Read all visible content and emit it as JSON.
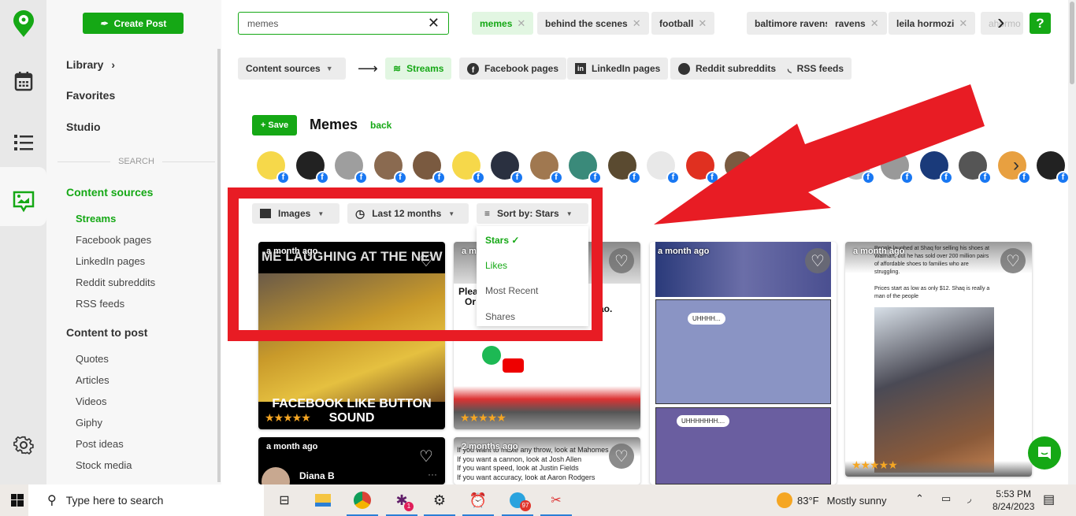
{
  "sidebar": {
    "create_post": "Create Post",
    "library": "Library",
    "favorites": "Favorites",
    "studio": "Studio",
    "search_divider": "SEARCH",
    "content_sources": {
      "label": "Content sources",
      "items": [
        "Streams",
        "Facebook pages",
        "LinkedIn pages",
        "Reddit subreddits",
        "RSS feeds"
      ]
    },
    "content_to_post": {
      "label": "Content to post",
      "items": [
        "Quotes",
        "Articles",
        "Videos",
        "Giphy",
        "Post ideas",
        "Stock media"
      ]
    }
  },
  "search": {
    "value": "memes"
  },
  "tags": [
    "memes",
    "behind the scenes",
    "football",
    "baltimore ravens",
    "ravens",
    "leila hormozi",
    "ahormo"
  ],
  "help_label": "?",
  "sources": {
    "dropdown": "Content sources",
    "items": [
      "Streams",
      "Facebook pages",
      "LinkedIn pages",
      "Reddit subreddits",
      "RSS feeds"
    ]
  },
  "stream": {
    "save": "+ Save",
    "title": "Memes",
    "back": "back"
  },
  "filters": {
    "type": "Images",
    "period": "Last 12 months",
    "sort": "Sort by: Stars",
    "sort_options": [
      "Stars",
      "Likes",
      "Most Recent",
      "Shares"
    ],
    "selected": "Stars"
  },
  "cards": [
    {
      "ago": "a month ago",
      "top_text": "ME LAUGHING AT THE NEW",
      "bottom_text": "FACEBOOK LIKE BUTTON SOUND",
      "stars": "★★★★★"
    },
    {
      "ago": "a month ago",
      "text1": "Plea",
      "text2": "Or",
      "text3": "ao.",
      "stars": "★★★★★"
    },
    {
      "ago": "a month ago",
      "bubble1": "UHHHH...",
      "bubble2": "UHHHHHHH...."
    },
    {
      "ago": "a month ago",
      "caption": "People laughed at Shaq for selling his shoes at Walmart, but he has sold over 200 million pairs of affordable shoes to families who are struggling.",
      "caption2": "Prices start as low as only $12. Shaq is really a man of the people",
      "stars": "★★★★★"
    },
    {
      "ago": "a month ago",
      "author": "Diana B"
    },
    {
      "ago": "2 months ago",
      "lines": [
        "If you want to make any throw, look at Mahomes",
        "If you want a cannon, look at Josh Allen",
        "If you want speed, look at Justin Fields",
        "If you want accuracy, look at Aaron Rodgers"
      ]
    }
  ],
  "taskbar": {
    "search_placeholder": "Type here to search",
    "slack_badge": "1",
    "telegram_badge": "97",
    "weather": "83°F",
    "weather_desc": "Mostly sunny",
    "time": "5:53 PM",
    "date": "8/24/2023"
  },
  "colors": {
    "brand": "#15a815",
    "annotation": "#e81c24",
    "facebook": "#1877f2",
    "stars": "#f5a623"
  }
}
